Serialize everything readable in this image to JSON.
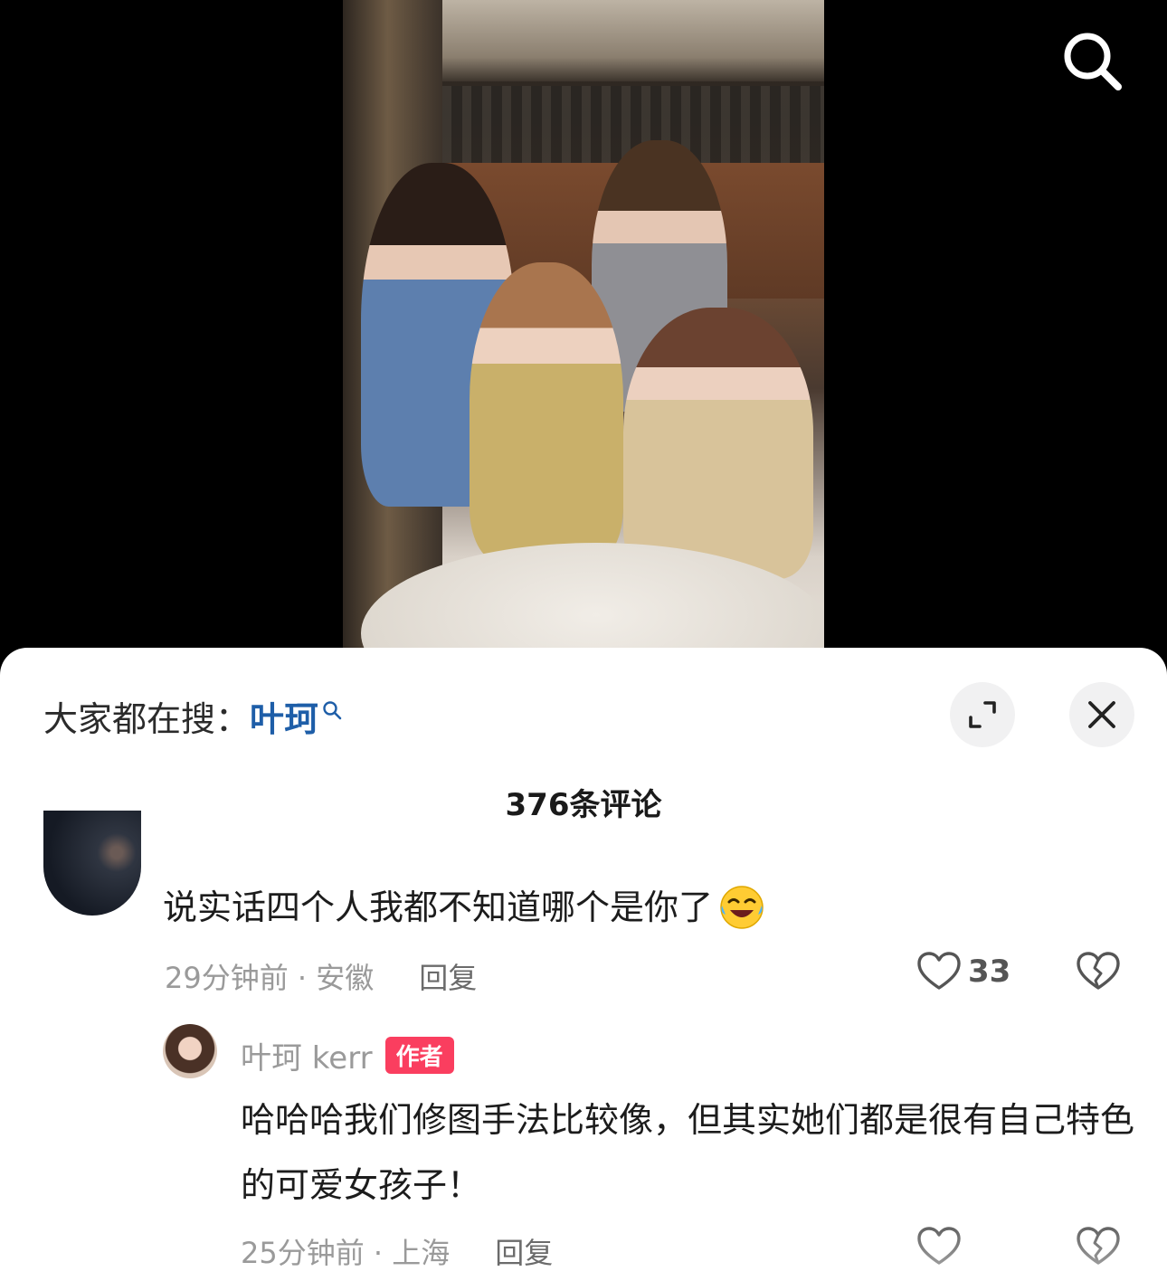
{
  "search": {
    "icon": "search-icon"
  },
  "trending": {
    "prefix": "大家都在搜：",
    "keyword": "叶珂",
    "keyword_color": "#1e5ea8"
  },
  "sheet_controls": {
    "expand_icon": "expand-icon",
    "close_icon": "close-icon"
  },
  "comments_header": {
    "count_label": "376条评论"
  },
  "comments": [
    {
      "text": "说实话四个人我都不知道哪个是你了",
      "emoji": "rolling-laughing-emoji",
      "time_location": "29分钟前 · 安徽",
      "reply_label": "回复",
      "likes": "33"
    },
    {
      "author": "叶珂 kerr",
      "badge": "作者",
      "badge_color": "#fa3e5f",
      "text": "哈哈哈我们修图手法比较像，但其实她们都是很有自己特色的可爱女孩子！",
      "time_location": "25分钟前 · 上海",
      "reply_label": "回复"
    }
  ]
}
